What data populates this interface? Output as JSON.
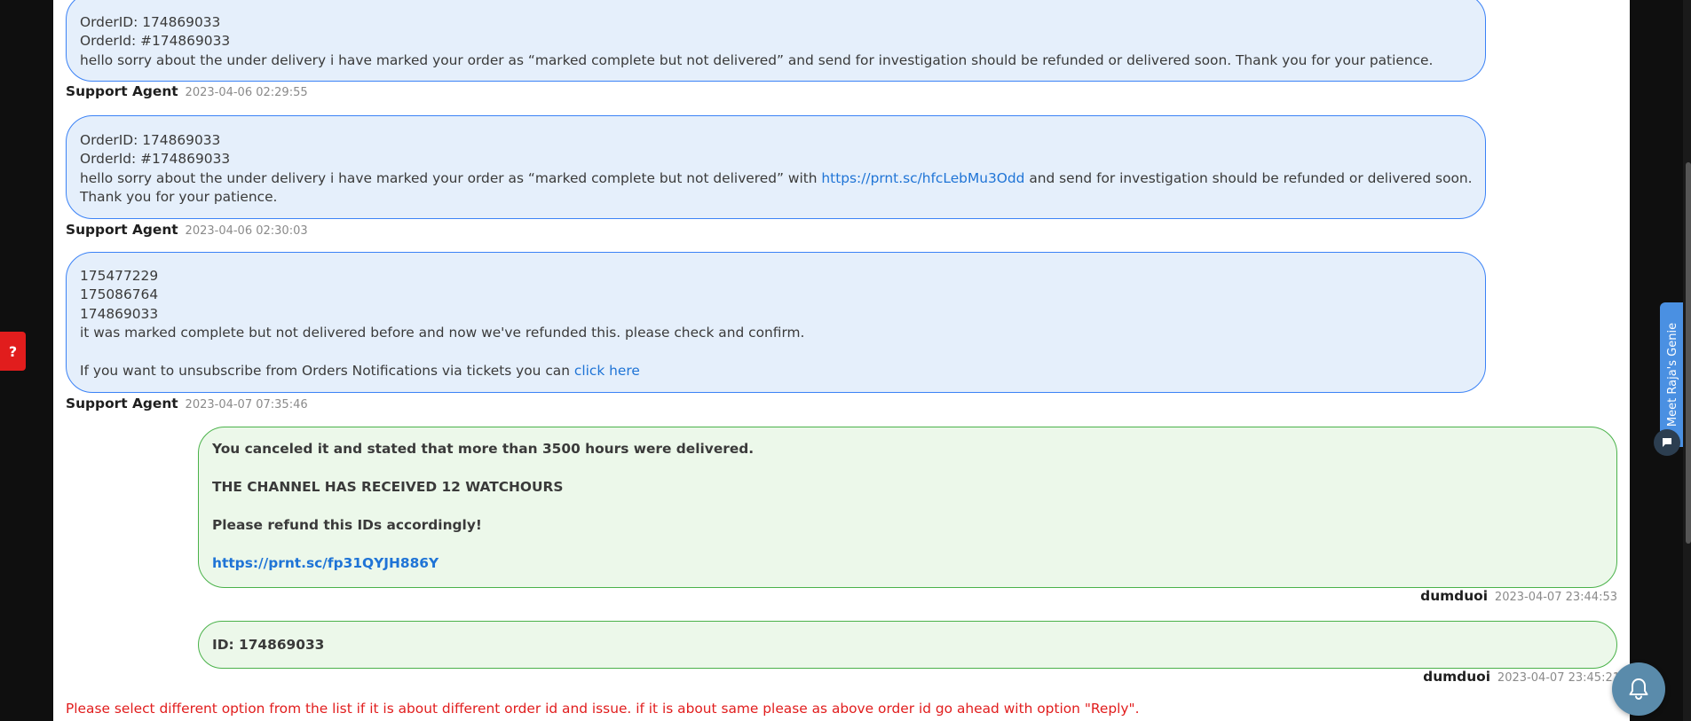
{
  "messages": [
    {
      "lines": [
        "OrderID: 174869033",
        "OrderId: #174869033",
        "hello sorry about the under delivery i have marked your order as “marked complete but not delivered” and send for investigation should be refunded or delivered soon. Thank you for your patience."
      ],
      "author": "Support Agent",
      "time": "2023-04-06 02:29:55"
    },
    {
      "lines": [
        "OrderID: 174869033",
        "OrderId: #174869033"
      ],
      "line3_before": "hello sorry about the under delivery i have marked your order as “marked complete but not delivered” with ",
      "line3_link": "https://prnt.sc/hfcLebMu3Odd",
      "line3_after": " and send for investigation should be refunded or delivered soon.",
      "line4": "Thank you for your patience.",
      "author": "Support Agent",
      "time": "2023-04-06 02:30:03"
    },
    {
      "lines": [
        "175477229",
        "175086764",
        "174869033",
        "it was marked complete but not delivered before and now we've refunded this. please check and confirm."
      ],
      "unsub_text": "If you want to unsubscribe from Orders Notifications via tickets you can ",
      "unsub_link": "click here",
      "author": "Support Agent",
      "time": "2023-04-07 07:35:46"
    },
    {
      "lines": [
        "You canceled it and stated that more than 3500 hours were delivered.",
        "THE CHANNEL HAS RECEIVED 12 WATCHOURS",
        "Please refund this IDs accordingly!"
      ],
      "link": "https://prnt.sc/fp31QYJH886Y",
      "author": "dumduoi",
      "time": "2023-04-07 23:44:53"
    },
    {
      "lines": [
        "ID: 174869033"
      ],
      "author": "dumduoi",
      "time": "2023-04-07 23:45:21"
    }
  ],
  "notice": "Please select different option from the list if it is about different order id and issue. if it is about same please as above order id go ahead with option \"Reply\".",
  "widgets": {
    "help_label": "?",
    "genie_label": "Meet Raja's Genie"
  },
  "colors": {
    "agent_bubble_bg": "#e5effb",
    "agent_bubble_border": "#3b82f6",
    "user_bubble_bg": "#ecf8ea",
    "user_bubble_border": "#4ab24a",
    "notice": "#e11d1d",
    "link": "#1f74d6"
  }
}
